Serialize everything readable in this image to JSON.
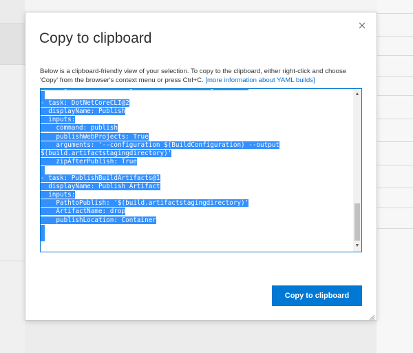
{
  "dialog": {
    "title": "Copy to clipboard",
    "description": "Below is a clipboard-friendly view of your selection. To copy to the clipboard, either right-click and choose 'Copy' from the browser's context menu or press Ctrl+C.",
    "link_text": "[more information about YAML builds]",
    "close_icon": "close-icon",
    "copy_button_label": "Copy to clipboard"
  },
  "code_lines": [
    "    arguments: '--configuration $(BuildConfiguration)'",
    "",
    "- task: DotNetCoreCLI@2",
    "  displayName: Publish",
    "  inputs:",
    "    command: publish",
    "    publishWebProjects: True",
    "    arguments: '--configuration $(BuildConfiguration) --output",
    "$(build.artifactstagingdirectory)'",
    "    zipAfterPublish: True",
    "",
    "- task: PublishBuildArtifacts@1",
    "  displayName: Publish Artifact",
    "  inputs:",
    "    PathtoPublish: '$(build.artifactstagingdirectory)'",
    "    ArtifactName: drop",
    "    publishLocation: Container",
    "",
    ""
  ],
  "colors": {
    "accent": "#0078d4",
    "selection": "#3390ff",
    "link": "#0a6ed1"
  }
}
